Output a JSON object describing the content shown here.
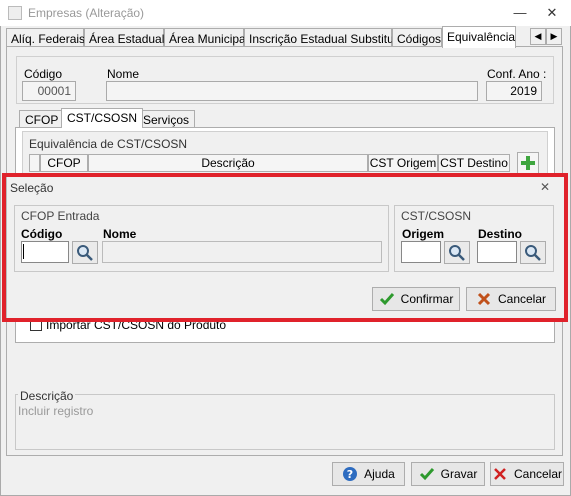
{
  "window": {
    "title": "Empresas (Alteração)",
    "minimize": "—",
    "close": "✕"
  },
  "tabs": [
    {
      "label": "Alíq. Federais"
    },
    {
      "label": "Área Estadual"
    },
    {
      "label": "Área Municipal"
    },
    {
      "label": "Inscrição Estadual Substituto"
    },
    {
      "label": "Códigos"
    },
    {
      "label": "Equivalência"
    }
  ],
  "header": {
    "codigo_label": "Código",
    "codigo_value": "00001",
    "nome_label": "Nome",
    "nome_value": "",
    "conf_ano_label": "Conf. Ano :",
    "conf_ano_value": "2019"
  },
  "inner_tabs": [
    {
      "label": "CFOP"
    },
    {
      "label": "CST/CSOSN"
    },
    {
      "label": "Serviços"
    }
  ],
  "equivalencia": {
    "title": "Equivalência de CST/CSOSN",
    "columns": [
      "CFOP",
      "Descrição",
      "CST Origem",
      "CST Destino"
    ]
  },
  "importar_label": "Importar CST/CSOSN do Produto",
  "dialog": {
    "title": "Seleção",
    "cfop_group": "CFOP Entrada",
    "codigo_label": "Código",
    "nome_label": "Nome",
    "cst_group": "CST/CSOSN",
    "origem_label": "Origem",
    "destino_label": "Destino",
    "confirmar": "Confirmar",
    "cancelar": "Cancelar"
  },
  "descricao": {
    "label": "Descrição",
    "value": "Incluir registro"
  },
  "footer": {
    "ajuda": "Ajuda",
    "gravar": "Gravar",
    "cancelar": "Cancelar"
  }
}
